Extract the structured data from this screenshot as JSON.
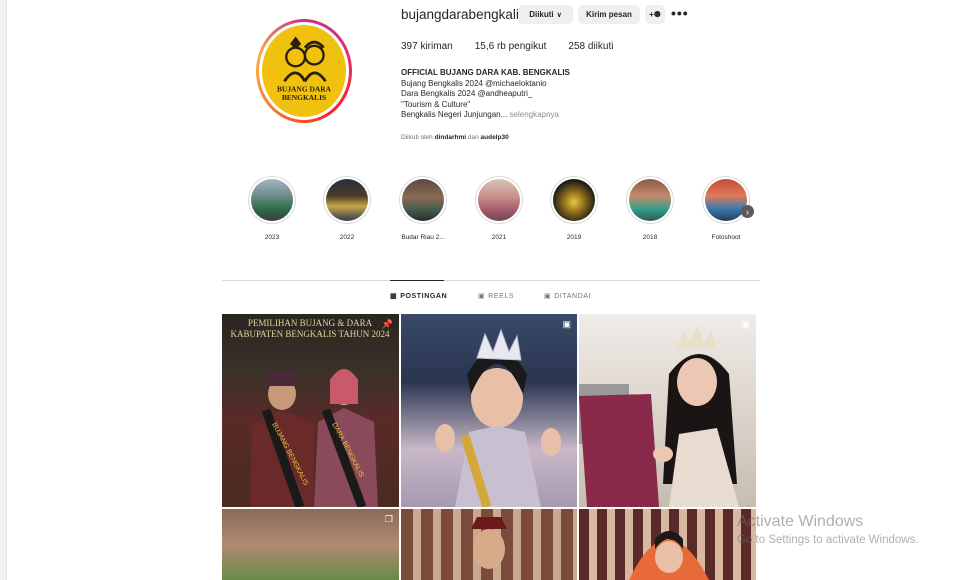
{
  "profile": {
    "username": "bujangdarabengkalis",
    "follow_button": "Diikuti",
    "message_button": "Kirim pesan",
    "suggest_icon": "person-add-icon",
    "more_icon": "more-horizontal-icon",
    "avatar_text_line1": "BUJANG DARA",
    "avatar_text_line2": "BENGKALIS"
  },
  "stats": {
    "posts": "397 kiriman",
    "followers": "15,6 rb pengikut",
    "following": "258 diikuti"
  },
  "bio": {
    "name": "OFFICIAL BUJANG DARA KAB. BENGKALIS",
    "line1": "Bujang Bengkalis 2024 @michaeloktanio",
    "line2": "Dara Bengkalis 2024 @andheaputri_",
    "line3": "\"Tourism & Culture\"",
    "line4": "Bengkalis Negeri Junjungan...",
    "more": "selengkapnya"
  },
  "followed_by": {
    "prefix": "Diikuti oleh",
    "user1": "dindarhmi",
    "conj": "dan",
    "user2": "audelp30"
  },
  "highlights": [
    {
      "label": "2023"
    },
    {
      "label": "2022"
    },
    {
      "label": "Budar Riau 2..."
    },
    {
      "label": "2021"
    },
    {
      "label": "2019"
    },
    {
      "label": "2018"
    },
    {
      "label": "Fotoshoot"
    }
  ],
  "tabs": [
    {
      "label": "POSTINGAN",
      "icon": "grid-icon"
    },
    {
      "label": "REELS",
      "icon": "reels-icon"
    },
    {
      "label": "DITANDAI",
      "icon": "tagged-icon"
    }
  ],
  "posts": {
    "first_banner_line1": "PEMILIHAN BUJANG & DARA",
    "first_banner_line2": "KABUPATEN BENGKALIS TAHUN 2024",
    "sash_left": "BUJANG BENGKALIS",
    "sash_right": "DARA BENGKALIS"
  },
  "watermark": {
    "title": "Activate Windows",
    "subtitle": "Go to Settings to activate Windows."
  },
  "colors": {
    "avatar_bg": "#f0c20f",
    "accent": "#c13584"
  }
}
